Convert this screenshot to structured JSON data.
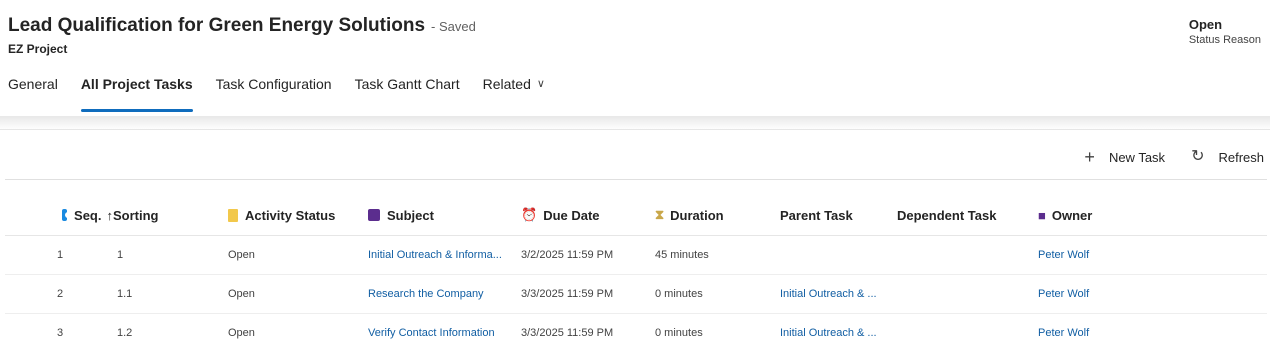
{
  "header": {
    "title": "Lead Qualification for Green Energy Solutions",
    "saved": "- Saved",
    "entity": "EZ Project",
    "status_value": "Open",
    "status_label": "Status Reason"
  },
  "tabs": [
    {
      "label": "General",
      "active": false
    },
    {
      "label": "All Project Tasks",
      "active": true
    },
    {
      "label": "Task Configuration",
      "active": false
    },
    {
      "label": "Task Gantt Chart",
      "active": false
    },
    {
      "label": "Related",
      "active": false,
      "icon": "chevron-down-icon"
    }
  ],
  "toolbar": {
    "new_task_icon": "plus-icon",
    "new_task_label": "New Task",
    "refresh_icon": "refresh-icon",
    "refresh_label": "Refresh"
  },
  "grid": {
    "columns": [
      {
        "label": "Seq.",
        "icon": "sequence-icon",
        "sort": "ascending"
      },
      {
        "label": "Sorting"
      },
      {
        "label": "Activity Status",
        "icon": "activity-status-icon"
      },
      {
        "label": "Subject",
        "icon": "subject-icon"
      },
      {
        "label": "Due Date",
        "icon": "alarm-clock-icon"
      },
      {
        "label": "Duration",
        "icon": "hourglass-icon"
      },
      {
        "label": "Parent Task"
      },
      {
        "label": "Dependent Task"
      },
      {
        "label": "Owner",
        "icon": "person-icon"
      }
    ],
    "rows": [
      {
        "seq": "1",
        "sorting": "1",
        "status": "Open",
        "subject": "Initial Outreach & Informa...",
        "due": "3/2/2025 11:59 PM",
        "duration": "45 minutes",
        "parent": "",
        "dependent": "",
        "owner": "Peter Wolf"
      },
      {
        "seq": "2",
        "sorting": "1.1",
        "status": "Open",
        "subject": "Research the Company",
        "due": "3/3/2025 11:59 PM",
        "duration": "0 minutes",
        "parent": "Initial Outreach & ...",
        "dependent": "",
        "owner": "Peter Wolf"
      },
      {
        "seq": "3",
        "sorting": "1.2",
        "status": "Open",
        "subject": "Verify Contact Information",
        "due": "3/3/2025 11:59 PM",
        "duration": "0 minutes",
        "parent": "Initial Outreach & ...",
        "dependent": "",
        "owner": "Peter Wolf"
      }
    ]
  },
  "colors": {
    "accent": "#0f6cbd",
    "link": "#115ea3",
    "sequence_icon": "#1a8ae0",
    "subject_icon": "#5b2d8e",
    "due_icon": "#e3562b",
    "activity_icon": "#f2c84b"
  }
}
